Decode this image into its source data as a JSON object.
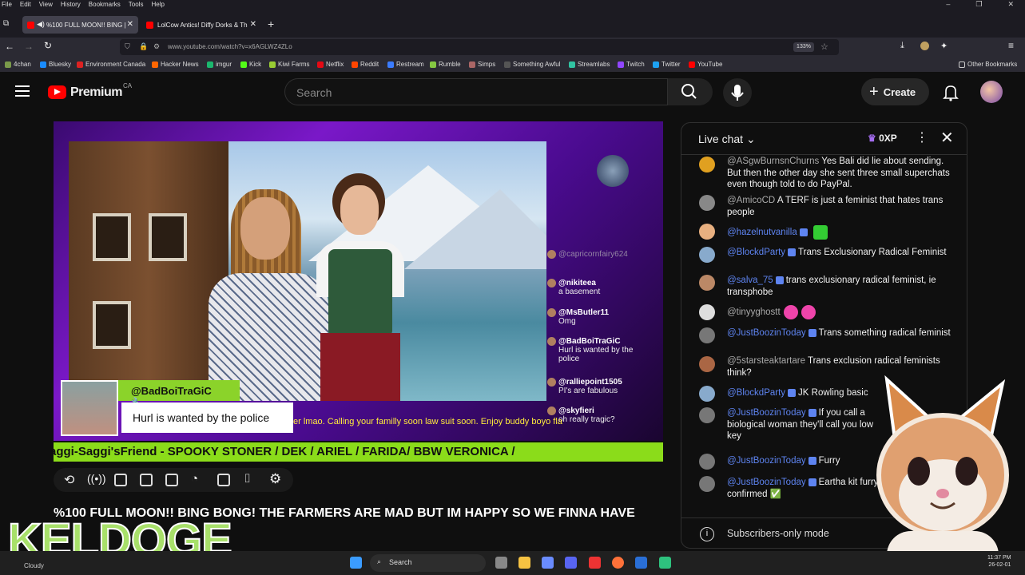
{
  "menubar": {
    "items": [
      "File",
      "Edit",
      "View",
      "History",
      "Bookmarks",
      "Tools",
      "Help"
    ]
  },
  "tabs": [
    {
      "label": "%100 FULL MOON!! BING |",
      "active": true
    },
    {
      "label": "LolCow Antics! Diffy Dorks & Th",
      "active": false
    }
  ],
  "nav": {
    "url": "www.youtube.com/watch?v=x6AGLWZ4ZLo",
    "zoom": "133%"
  },
  "bookmarks": [
    "4chan",
    "Bluesky",
    "Environment Canada",
    "Hacker News",
    "imgur",
    "Kick",
    "Kiwi Farms",
    "Netflix",
    "Reddit",
    "Restream",
    "Rumble",
    "Simps",
    "Something Awful",
    "Streamlabs",
    "Twitch",
    "Twitter",
    "YouTube"
  ],
  "other_bookmarks": "Other Bookmarks",
  "yt": {
    "brand": "Premium",
    "region": "CA",
    "search_placeholder": "Search",
    "create_label": "Create"
  },
  "video": {
    "overlay_name": "@BadBoiTraGiC",
    "overlay_message": "Hurl is wanted by the police",
    "ticker_top": "er lmao. Calling your familly soon law suit soon. Enjoy buddy boyo fla",
    "ticker": "aggi-Saggi'sFriend - SPOOKY STONER / DEK / ARIEL / FARIDA/ BBW VERONICA /",
    "stream_chat": [
      {
        "name": "@capricornfairy624",
        "msg": ""
      },
      {
        "name": "@nikiteea",
        "msg": "a basement"
      },
      {
        "name": "@MsButler11",
        "msg": "Omg"
      },
      {
        "name": "@BadBoiTraGiC",
        "msg": "Hurl is wanted by the police"
      },
      {
        "name": "@ralliepoint1505",
        "msg": "PI's are fabulous"
      },
      {
        "name": "@skyfieri",
        "msg": "oh really tragic?"
      }
    ],
    "title": "%100 FULL MOON!! BING BONG! THE FARMERS ARE MAD BUT IM HAPPY SO WE FINNA HAVE"
  },
  "watermark": "KELDOGE",
  "chat": {
    "title": "Live chat",
    "xp": "0XP",
    "footer": "Subscribers-only mode",
    "messages": [
      {
        "author": "@ASgwBurnsnChurns",
        "mod": false,
        "text": "Yes Bali did lie about sending. But then the other day she sent three small superchats even though told to do PayPal."
      },
      {
        "author": "@AmicoCD",
        "mod": false,
        "text": "A TERF is just a feminist that hates trans people"
      },
      {
        "author": "@hazelnutvanilla",
        "mod": true,
        "text": ""
      },
      {
        "author": "@BlockdParty",
        "mod": true,
        "text": "Trans Exclusionary Radical Feminist"
      },
      {
        "author": "@salva_75",
        "mod": true,
        "text": "trans exclusionary radical feminist, ie transphobe"
      },
      {
        "author": "@tinyyghostt",
        "mod": false,
        "text": ""
      },
      {
        "author": "@JustBoozinToday",
        "mod": true,
        "text": "Trans something radical feminist"
      },
      {
        "author": "@5starsteaktartare",
        "mod": false,
        "text": "Trans exclusion radical feminists think?"
      },
      {
        "author": "@BlockdParty",
        "mod": true,
        "text": "JK Rowling basic"
      },
      {
        "author": "@JustBoozinToday",
        "mod": true,
        "text": "If you call a biological woman they'll call you low key"
      },
      {
        "author": "@JustBoozinToday",
        "mod": true,
        "text": "Furry"
      },
      {
        "author": "@JustBoozinToday",
        "mod": true,
        "text": "Eartha kit furry confirmed ✅"
      }
    ]
  },
  "taskbar": {
    "search": "Search",
    "weather": "Cloudy",
    "time": "11:37 PM",
    "date": "26-02-01"
  }
}
